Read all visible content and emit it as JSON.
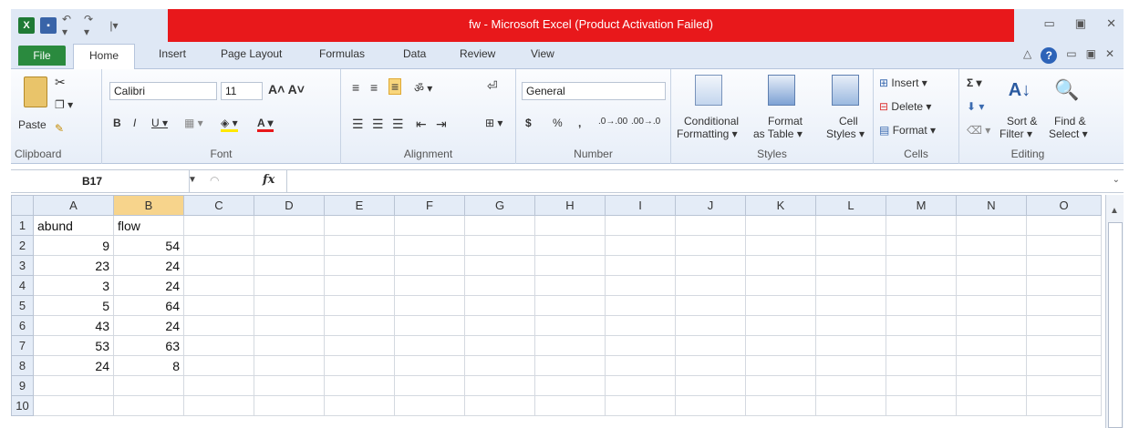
{
  "window": {
    "title": "fw - Microsoft Excel (Product Activation Failed)",
    "icons": [
      "excel-logo-icon",
      "save-icon",
      "undo-icon",
      "redo-icon",
      "customize-qat-icon"
    ],
    "controls": [
      "minimize-icon",
      "restore-icon",
      "close-icon"
    ]
  },
  "tabs": [
    "File",
    "Home",
    "Insert",
    "Page Layout",
    "Formulas",
    "Data",
    "Review",
    "View"
  ],
  "ribbon": {
    "clipboard": {
      "paste": "Paste",
      "label": "Clipboard"
    },
    "font": {
      "name": "Calibri",
      "size": "11",
      "label": "Font"
    },
    "alignment": {
      "label": "Alignment"
    },
    "number": {
      "format": "General",
      "currency": "$",
      "percent": "%",
      "comma": ",",
      "label": "Number"
    },
    "styles": {
      "conditional": "Conditional",
      "conditional2": "Formatting ▾",
      "format_table": "Format",
      "format_table2": "as Table ▾",
      "cell_styles": "Cell",
      "cell_styles2": "Styles ▾",
      "label": "Styles"
    },
    "cells": {
      "insert": "Insert ▾",
      "delete": "Delete ▾",
      "format": "Format ▾",
      "label": "Cells"
    },
    "editing": {
      "sum": "Σ ▾",
      "sort": "Sort &",
      "sort2": "Filter ▾",
      "find": "Find &",
      "find2": "Select ▾",
      "label": "Editing"
    }
  },
  "formula_bar": {
    "name_box": "B17",
    "fx": "fx",
    "formula": ""
  },
  "grid": {
    "columns": [
      "A",
      "B",
      "C",
      "D",
      "E",
      "F",
      "G",
      "H",
      "I",
      "J",
      "K",
      "L",
      "M",
      "N",
      "O"
    ],
    "selected_column": "B",
    "rows": [
      {
        "n": "1",
        "A": "abund",
        "B": "flow"
      },
      {
        "n": "2",
        "A": "9",
        "B": "54"
      },
      {
        "n": "3",
        "A": "23",
        "B": "24"
      },
      {
        "n": "4",
        "A": "3",
        "B": "24"
      },
      {
        "n": "5",
        "A": "5",
        "B": "64"
      },
      {
        "n": "6",
        "A": "43",
        "B": "24"
      },
      {
        "n": "7",
        "A": "53",
        "B": "63"
      },
      {
        "n": "8",
        "A": "24",
        "B": "8"
      },
      {
        "n": "9",
        "A": "",
        "B": ""
      },
      {
        "n": "10",
        "A": "",
        "B": ""
      }
    ]
  }
}
